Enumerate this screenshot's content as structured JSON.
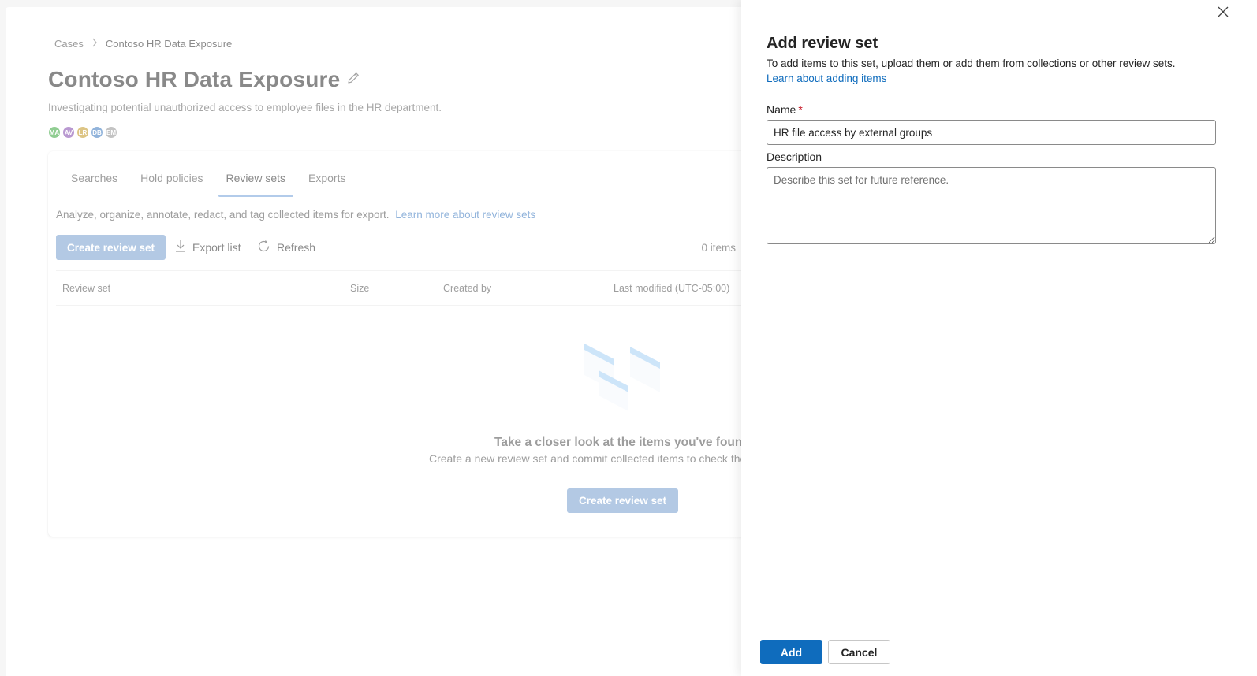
{
  "breadcrumb": {
    "root": "Cases",
    "current": "Contoso HR Data Exposure"
  },
  "case": {
    "title": "Contoso HR Data Exposure",
    "description": "Investigating potential unauthorized access to employee files in the HR department."
  },
  "members": [
    {
      "initials": "MA",
      "color": "#4caf50"
    },
    {
      "initials": "AV",
      "color": "#8e5bb5"
    },
    {
      "initials": "LR",
      "color": "#c9a23a"
    },
    {
      "initials": "DB",
      "color": "#4f86c6"
    },
    {
      "initials": "EM",
      "color": "#9e9e9e"
    }
  ],
  "tabs": [
    {
      "label": "Searches"
    },
    {
      "label": "Hold policies"
    },
    {
      "label": "Review sets"
    },
    {
      "label": "Exports"
    }
  ],
  "review_sets": {
    "intro": "Analyze, organize, annotate, redact, and tag collected items for export.",
    "learn_more": "Learn more about review sets",
    "toolbar": {
      "create_label": "Create review set",
      "export_label": "Export list",
      "refresh_label": "Refresh",
      "items_count": "0 items"
    },
    "columns": [
      "Review set",
      "Size",
      "Created by",
      "Last modified (UTC-05:00)"
    ],
    "empty": {
      "title": "Take a closer look at the items you've found",
      "subtitle": "Create a new review set and commit collected items to check them",
      "button": "Create review set"
    }
  },
  "panel": {
    "title": "Add review set",
    "intro": "To add items to this set, upload them or add them from collections or other review sets.",
    "link": "Learn about adding items",
    "name_label": "Name",
    "required_mark": "*",
    "name_value": "HR file access by external groups",
    "description_label": "Description",
    "description_placeholder": "Describe this set for future reference.",
    "add_label": "Add",
    "cancel_label": "Cancel"
  },
  "colors": {
    "primary": "#0f6cbd",
    "primary_faded": "#85a9d4",
    "required": "#c50f1f"
  }
}
